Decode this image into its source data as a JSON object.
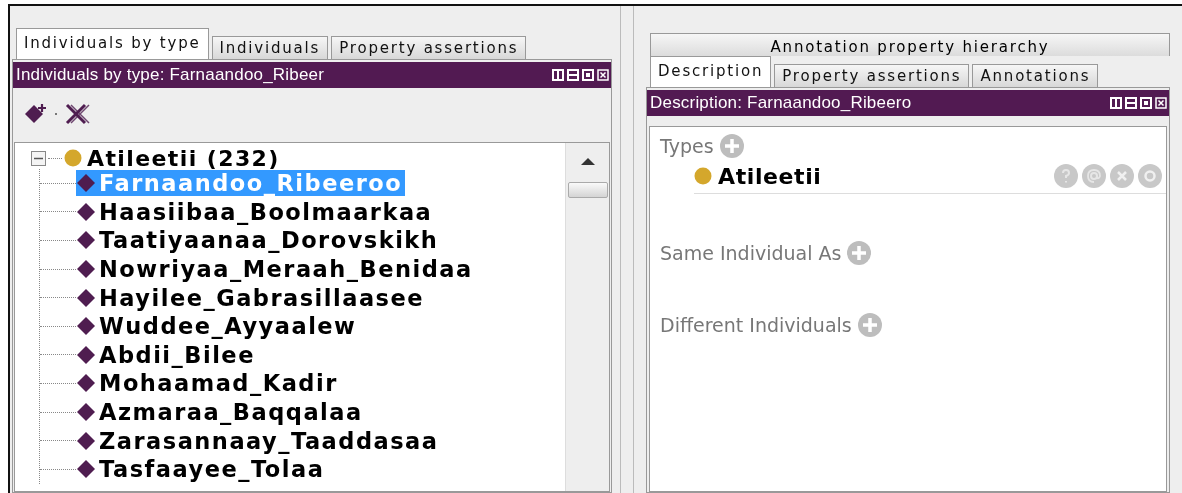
{
  "left_panel": {
    "tabs": [
      {
        "label": "Individuals by type",
        "selected": true
      },
      {
        "label": "Individuals",
        "selected": false
      },
      {
        "label": "Property assertions",
        "selected": false
      }
    ],
    "view_title": "Individuals by type: Farnaandoo_Ribeer",
    "tree": {
      "label": "Atileetii (232)",
      "expanded": true,
      "children": [
        {
          "label": "Farnaandoo_Ribeeroo",
          "selected": true
        },
        {
          "label": "Haasiibaa_Boolmaarkaa",
          "selected": false
        },
        {
          "label": "Taatiyaanaa_Dorovskikh",
          "selected": false
        },
        {
          "label": "Nowriyaa_Meraah_Benidaa",
          "selected": false
        },
        {
          "label": "Hayilee_Gabrasillaasee",
          "selected": false
        },
        {
          "label": "Wuddee_Ayyaalew",
          "selected": false
        },
        {
          "label": "Abdii_Bilee",
          "selected": false
        },
        {
          "label": "Mohaamad_Kadir",
          "selected": false
        },
        {
          "label": "Azmaraa_Baqqalaa",
          "selected": false
        },
        {
          "label": "Zarasannaay_Taaddasaa",
          "selected": false
        },
        {
          "label": "Tasfaayee_Tolaa",
          "selected": false
        }
      ]
    }
  },
  "right_panel": {
    "top_tab": {
      "label": "Annotation property hierarchy",
      "selected": false
    },
    "tabs": [
      {
        "label": "Description",
        "selected": true
      },
      {
        "label": "Property assertions",
        "selected": false
      },
      {
        "label": "Annotations",
        "selected": false
      }
    ],
    "view_title": "Description: Farnaandoo_Ribeero",
    "sections": [
      {
        "title": "Types",
        "items": [
          {
            "label": "Atileetii"
          }
        ]
      },
      {
        "title": "Same Individual As"
      },
      {
        "title": "Different Individuals"
      }
    ]
  }
}
